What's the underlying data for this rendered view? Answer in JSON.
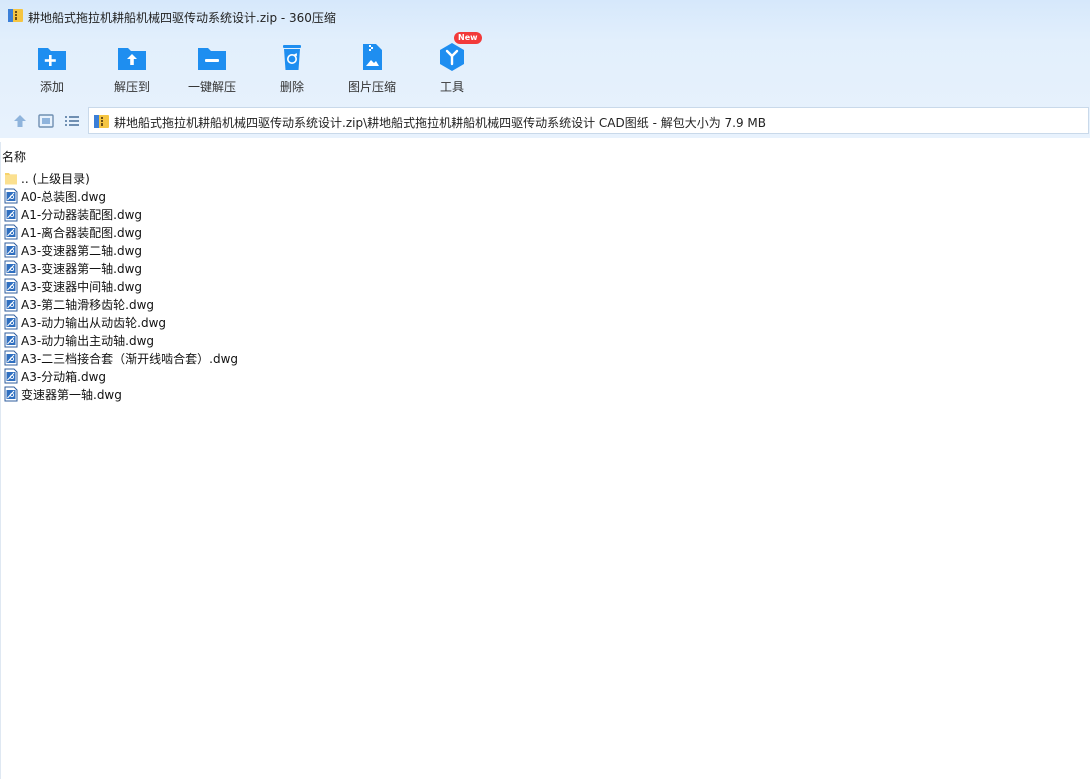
{
  "window": {
    "title": "耕地船式拖拉机耕船机械四驱传动系统设计.zip - 360压缩"
  },
  "toolbar": {
    "add_label": "添加",
    "extract_to_label": "解压到",
    "one_click_extract_label": "一键解压",
    "delete_label": "删除",
    "image_compress_label": "图片压缩",
    "tools_label": "工具",
    "new_badge": "New"
  },
  "address": {
    "path": "耕地船式拖拉机耕船机械四驱传动系统设计.zip\\耕地船式拖拉机耕船机械四驱传动系统设计 CAD图纸 - 解包大小为 7.9 MB"
  },
  "columns": {
    "name": "名称"
  },
  "files": [
    {
      "name": ".. (上级目录)",
      "type": "folder"
    },
    {
      "name": "A0-总装图.dwg",
      "type": "dwg"
    },
    {
      "name": "A1-分动器装配图.dwg",
      "type": "dwg"
    },
    {
      "name": "A1-离合器装配图.dwg",
      "type": "dwg"
    },
    {
      "name": "A3-变速器第二轴.dwg",
      "type": "dwg"
    },
    {
      "name": "A3-变速器第一轴.dwg",
      "type": "dwg"
    },
    {
      "name": "A3-变速器中间轴.dwg",
      "type": "dwg"
    },
    {
      "name": "A3-第二轴滑移齿轮.dwg",
      "type": "dwg"
    },
    {
      "name": "A3-动力输出从动齿轮.dwg",
      "type": "dwg"
    },
    {
      "name": "A3-动力输出主动轴.dwg",
      "type": "dwg"
    },
    {
      "name": "A3-二三档接合套（渐开线啮合套）.dwg",
      "type": "dwg"
    },
    {
      "name": "A3-分动箱.dwg",
      "type": "dwg"
    },
    {
      "name": "变速器第一轴.dwg",
      "type": "dwg"
    }
  ],
  "colors": {
    "accent": "#1e8ef0",
    "badge": "#f23a3a",
    "chrome": "#dbeafb"
  }
}
